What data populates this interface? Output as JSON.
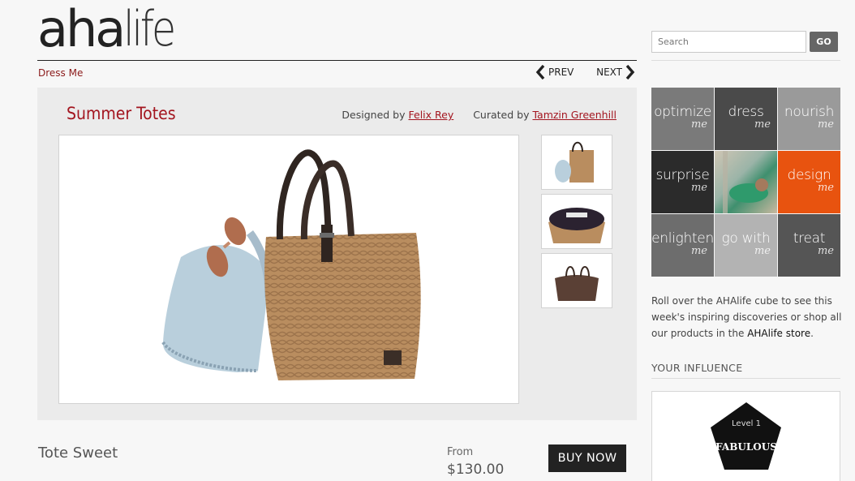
{
  "logo": {
    "part1": "aha",
    "part2": "life"
  },
  "breadcrumb": {
    "label": "Dress Me"
  },
  "pager": {
    "prev_label": "PREV",
    "next_label": "NEXT"
  },
  "feature": {
    "title": "Summer Totes",
    "designed_prefix": "Designed by",
    "designer": "Felix Rey",
    "curated_prefix": "Curated by",
    "curator": "Tamzin Greenhill"
  },
  "product": {
    "name": "Tote Sweet",
    "from_label": "From",
    "price": "$130.00",
    "buy_label": "BUY NOW"
  },
  "search": {
    "placeholder": "Search",
    "go_label": "GO"
  },
  "cube": [
    {
      "word": "optimize",
      "sub": "me",
      "color": "#7a7a7a"
    },
    {
      "word": "dress",
      "sub": "me",
      "color": "#4a4a4a"
    },
    {
      "word": "nourish",
      "sub": "me",
      "color": "#9a9a9a"
    },
    {
      "word": "surprise",
      "sub": "me",
      "color": "#2b2b2b"
    },
    {
      "word": "",
      "sub": "",
      "color": "#8a9a8f"
    },
    {
      "word": "design",
      "sub": "me",
      "color": "#e8530f"
    },
    {
      "word": "enlighten",
      "sub": "me",
      "color": "#6d6d6d"
    },
    {
      "word": "go with",
      "sub": "me",
      "color": "#b3b3b3"
    },
    {
      "word": "treat",
      "sub": "me",
      "color": "#555555"
    }
  ],
  "blurb": {
    "text": "Roll over the AHAlife cube to see this week's inspiring discoveries or shop all our products in the",
    "store": "AHAlife store",
    "end": "."
  },
  "influence": {
    "heading": "YOUR INFLUENCE",
    "level": "Level 1",
    "status": "FABULOUS"
  },
  "colors": {
    "accent": "#a3151f",
    "design_orange": "#e8530f"
  }
}
